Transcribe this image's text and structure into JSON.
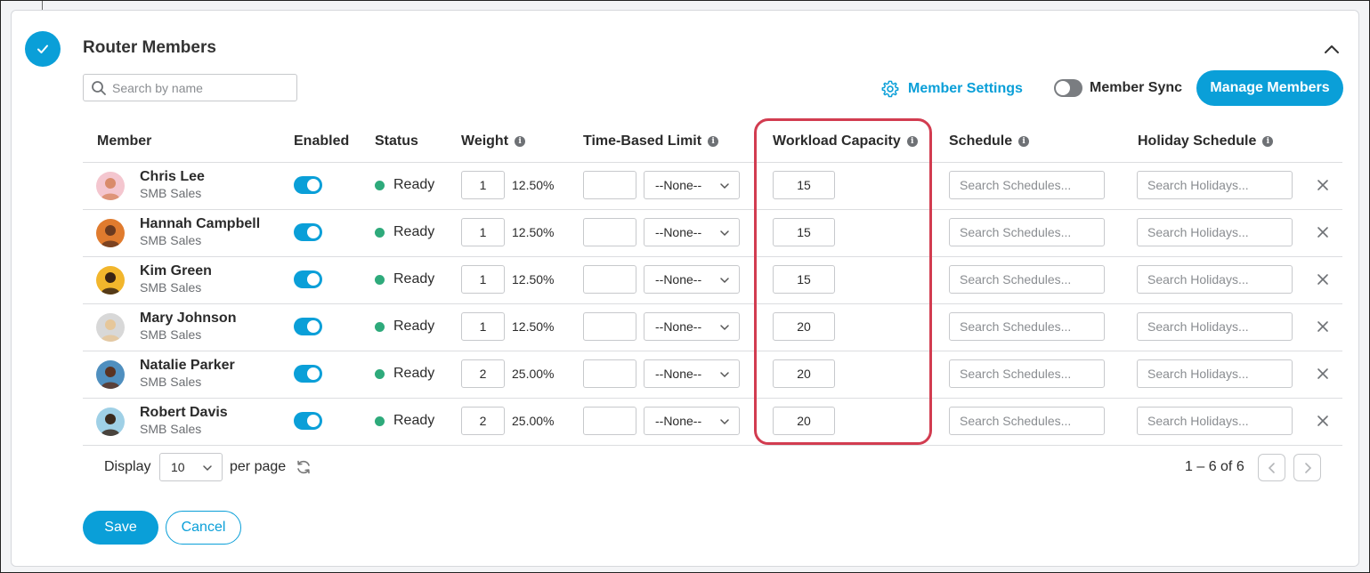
{
  "section": {
    "title": "Router Members",
    "search_placeholder": "Search by name",
    "member_settings_label": "Member Settings",
    "member_sync_label": "Member Sync",
    "member_sync_enabled": false,
    "manage_members_label": "Manage Members"
  },
  "table": {
    "headers": {
      "member": "Member",
      "enabled": "Enabled",
      "status": "Status",
      "weight": "Weight",
      "time_limit": "Time-Based Limit",
      "workload": "Workload Capacity",
      "schedule": "Schedule",
      "holiday": "Holiday Schedule"
    },
    "select_default": "--None--",
    "schedule_placeholder": "Search Schedules...",
    "holiday_placeholder": "Search Holidays...",
    "rows": [
      {
        "name": "Chris Lee",
        "team": "SMB Sales",
        "enabled": true,
        "status": "Ready",
        "weight": "1",
        "pct": "12.50%",
        "workload": "15"
      },
      {
        "name": "Hannah Campbell",
        "team": "SMB Sales",
        "enabled": true,
        "status": "Ready",
        "weight": "1",
        "pct": "12.50%",
        "workload": "15"
      },
      {
        "name": "Kim Green",
        "team": "SMB Sales",
        "enabled": true,
        "status": "Ready",
        "weight": "1",
        "pct": "12.50%",
        "workload": "15"
      },
      {
        "name": "Mary Johnson",
        "team": "SMB Sales",
        "enabled": true,
        "status": "Ready",
        "weight": "1",
        "pct": "12.50%",
        "workload": "20"
      },
      {
        "name": "Natalie Parker",
        "team": "SMB Sales",
        "enabled": true,
        "status": "Ready",
        "weight": "2",
        "pct": "25.00%",
        "workload": "20"
      },
      {
        "name": "Robert Davis",
        "team": "SMB Sales",
        "enabled": true,
        "status": "Ready",
        "weight": "2",
        "pct": "25.00%",
        "workload": "20"
      }
    ]
  },
  "footer": {
    "display_label": "Display",
    "per_page_value": "10",
    "per_page_label": "per page",
    "range": "1 – 6 of 6",
    "save_label": "Save",
    "cancel_label": "Cancel"
  },
  "colors": {
    "accent": "#0a9fd8",
    "ready": "#2eaa7b",
    "highlight": "#d23c50"
  }
}
